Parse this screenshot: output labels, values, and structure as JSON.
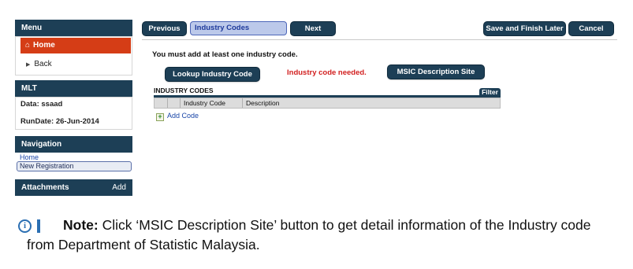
{
  "sidebar": {
    "menu_title": "Menu",
    "home_label": "Home",
    "back_label": "Back",
    "mlt_title": "MLT",
    "data_label": "Data: ssaad",
    "rundate_label": "RunDate: 26-Jun-2014",
    "navigation_title": "Navigation",
    "nav_home": "Home",
    "nav_new_registration": "New Registration",
    "attachments_title": "Attachments",
    "attachments_add": "Add"
  },
  "toolbar": {
    "previous": "Previous",
    "current_step": "Industry Codes",
    "next": "Next",
    "save_finish_later": "Save and Finish Later",
    "cancel": "Cancel"
  },
  "main": {
    "instruction": "You must add at least one industry code.",
    "lookup_button": "Lookup Industry Code",
    "error_message": "Industry code needed.",
    "msic_button": "MSIC Description Site",
    "table_title": "INDUSTRY CODES",
    "filter_label": "Filter",
    "columns": [
      "Industry Code",
      "Description"
    ],
    "add_code": "Add Code"
  },
  "note": {
    "prefix": "Note:",
    "text": " Click ‘MSIC Description Site’ button to get detail information of the Industry code from Department of Statistic Malaysia."
  },
  "colors": {
    "primary": "#1d3f56",
    "home_active": "#d53d16",
    "error": "#d22020",
    "link": "#1a46a8"
  }
}
